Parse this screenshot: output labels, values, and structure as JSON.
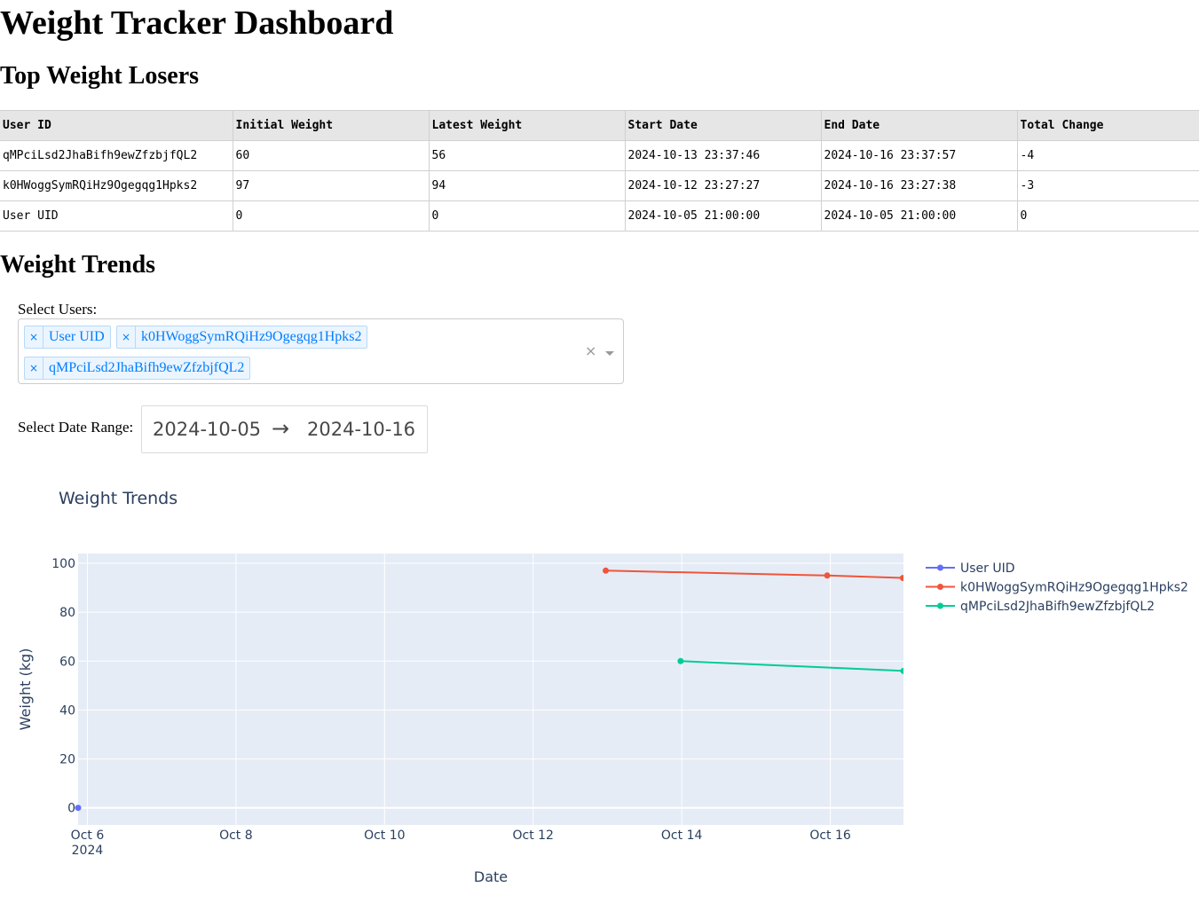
{
  "page": {
    "title": "Weight Tracker Dashboard",
    "losers_heading": "Top Weight Losers",
    "trends_heading": "Weight Trends"
  },
  "table": {
    "columns": [
      "User ID",
      "Initial Weight",
      "Latest Weight",
      "Start Date",
      "End Date",
      "Total Change"
    ],
    "rows": [
      [
        "qMPciLsd2JhaBifh9ewZfzbjfQL2",
        "60",
        "56",
        "2024-10-13 23:37:46",
        "2024-10-16 23:37:57",
        "-4"
      ],
      [
        "k0HWoggSymRQiHz9Ogegqg1Hpks2",
        "97",
        "94",
        "2024-10-12 23:27:27",
        "2024-10-16 23:27:38",
        "-3"
      ],
      [
        "User UID",
        "0",
        "0",
        "2024-10-05 21:00:00",
        "2024-10-05 21:00:00",
        "0"
      ]
    ]
  },
  "filters": {
    "users_label": "Select Users:",
    "selected_users": [
      "User UID",
      "k0HWoggSymRQiHz9Ogegqg1Hpks2",
      "qMPciLsd2JhaBifh9ewZfzbjfQL2"
    ],
    "remove_glyph": "×",
    "clear_glyph": "×",
    "date_label": "Select Date Range:",
    "start_date": "2024-10-05",
    "end_date": "2024-10-16",
    "arrow_glyph": "→"
  },
  "colors": {
    "plot_bg": "#e5ecf6",
    "series": [
      "#636efa",
      "#ef553b",
      "#00cc96"
    ]
  },
  "chart_data": {
    "type": "line",
    "title": "Weight Trends",
    "xlabel": "Date",
    "ylabel": "Weight (kg)",
    "x_type": "date",
    "xlim": [
      "2024-10-05 21:00:00",
      "2024-10-16 23:37:57"
    ],
    "ylim": [
      -7,
      104
    ],
    "x_ticks": [
      "2024-10-06",
      "2024-10-08",
      "2024-10-10",
      "2024-10-12",
      "2024-10-14",
      "2024-10-16"
    ],
    "x_tick_labels": [
      "Oct 6",
      "Oct 8",
      "Oct 10",
      "Oct 12",
      "Oct 14",
      "Oct 16"
    ],
    "x_tick_year": "2024",
    "y_ticks": [
      0,
      20,
      40,
      60,
      80,
      100
    ],
    "grid": true,
    "legend": "right",
    "series": [
      {
        "name": "User UID",
        "x": [
          "2024-10-05 21:00:00"
        ],
        "y": [
          0
        ]
      },
      {
        "name": "k0HWoggSymRQiHz9Ogegqg1Hpks2",
        "x": [
          "2024-10-12 23:27:27",
          "2024-10-15 23:00:00",
          "2024-10-16 23:27:38"
        ],
        "y": [
          97,
          95,
          94
        ]
      },
      {
        "name": "qMPciLsd2JhaBifh9ewZfzbjfQL2",
        "x": [
          "2024-10-13 23:37:46",
          "2024-10-16 23:37:57"
        ],
        "y": [
          60,
          56
        ]
      }
    ]
  }
}
